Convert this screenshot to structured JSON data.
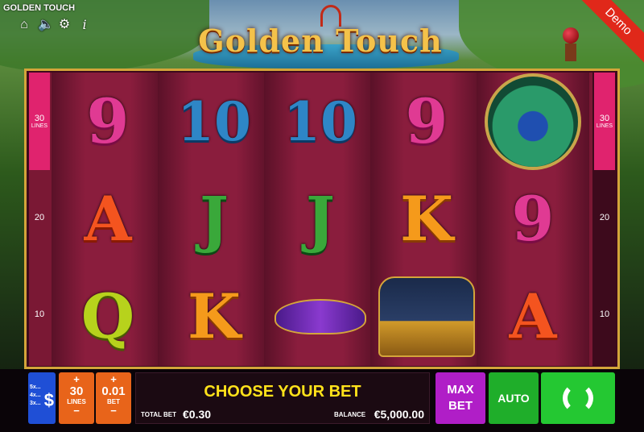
{
  "app_title": "GOLDEN TOUCH",
  "game_logo": "Golden Touch",
  "demo_badge": "Demo",
  "toolbar": {
    "icons": [
      "home-icon",
      "sound-icon",
      "settings-icon",
      "info-icon"
    ]
  },
  "reels": [
    [
      "9",
      "A",
      "Q"
    ],
    [
      "10",
      "J",
      "K"
    ],
    [
      "10",
      "J",
      "mask"
    ],
    [
      "9",
      "K",
      "carriage"
    ],
    [
      "peacock",
      "9",
      "A"
    ]
  ],
  "side_markers": {
    "top_value": "30",
    "top_label": "LINES",
    "mid_value": "20",
    "bottom_value": "10"
  },
  "controls": {
    "paytable": {
      "multipliers": [
        "5x...",
        "4x...",
        "3x..."
      ],
      "symbol": "$"
    },
    "lines": {
      "plus": "+",
      "value": "30",
      "label": "LINES",
      "minus": "−"
    },
    "bet": {
      "plus": "+",
      "value": "0.01",
      "label": "BET",
      "minus": "−"
    },
    "message": "CHOOSE YOUR BET",
    "total_bet_label": "TOTAL BET",
    "total_bet_value": "€0.30",
    "balance_label": "BALANCE",
    "balance_value": "€5,000.00",
    "max_bet_label_1": "MAX",
    "max_bet_label_2": "BET",
    "auto_label": "AUTO"
  },
  "colors": {
    "spin_green": "#24c832",
    "max_bet_purple": "#b01ec7",
    "lines_orange": "#e8641a",
    "paytable_blue": "#1f4fd6",
    "message_yellow": "#ffe21a"
  }
}
